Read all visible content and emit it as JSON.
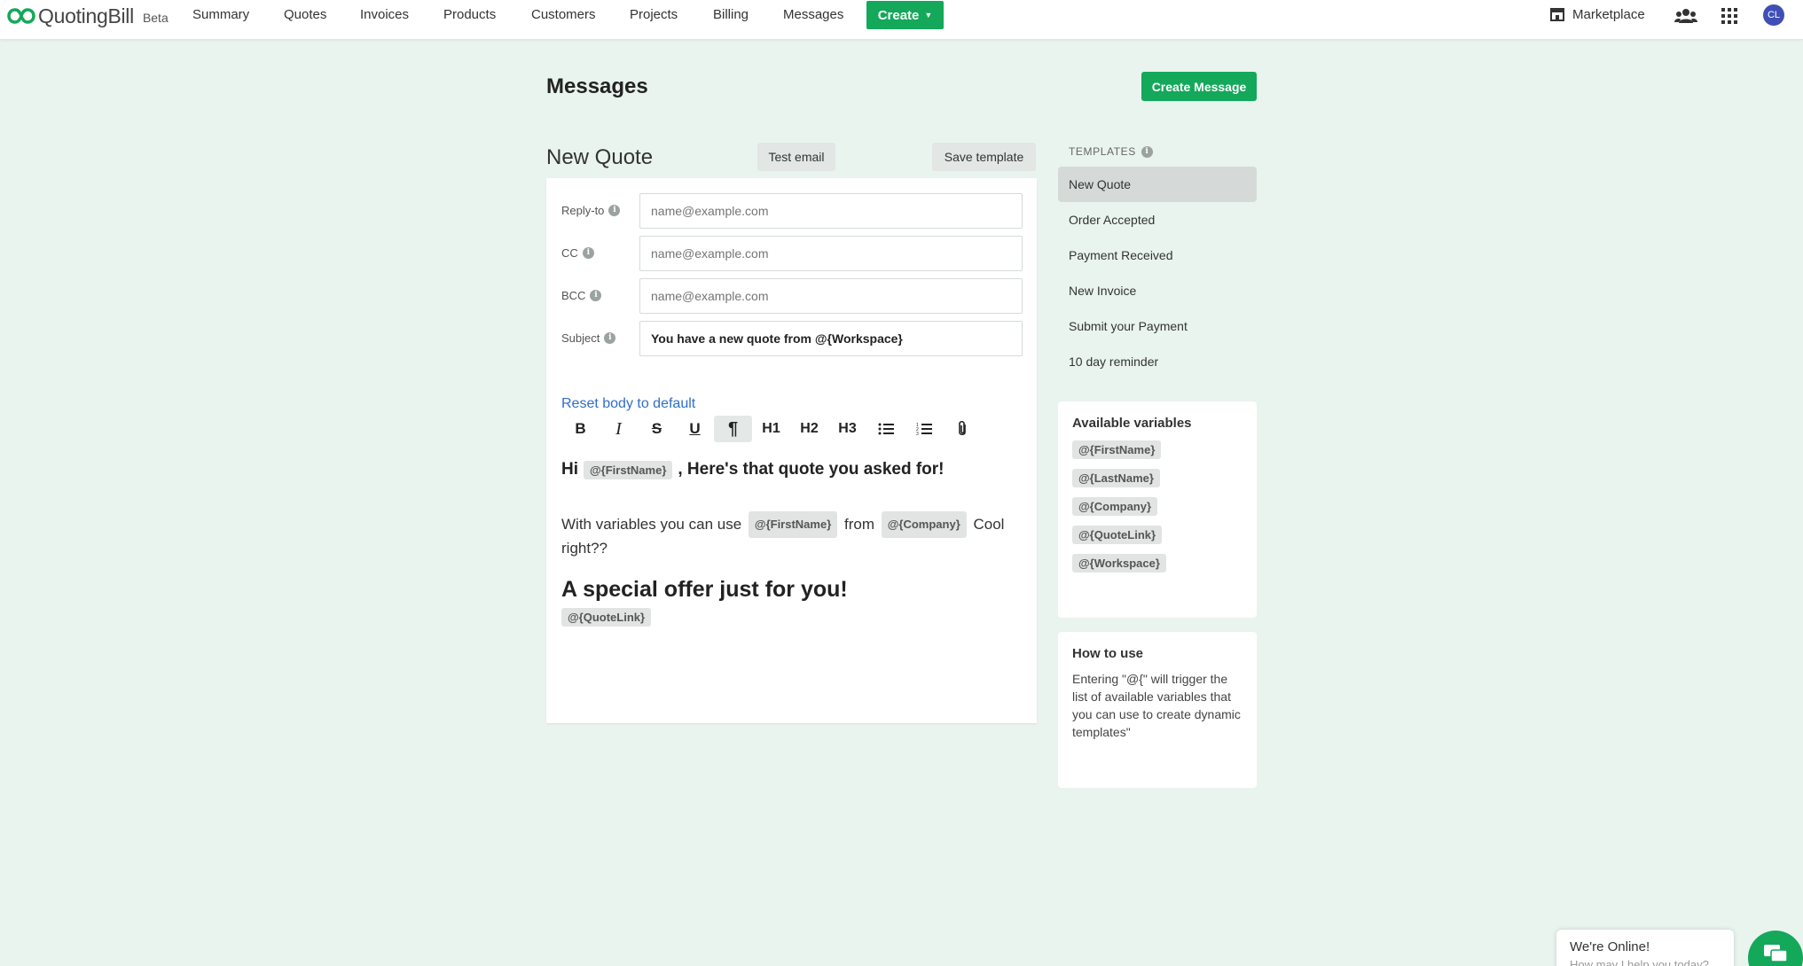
{
  "brand": {
    "name": "QuotingBill",
    "badge": "Beta",
    "logo_color": "#14a85a"
  },
  "nav": {
    "items": [
      "Summary",
      "Quotes",
      "Invoices",
      "Products",
      "Customers",
      "Projects",
      "Billing",
      "Messages"
    ],
    "create_label": "Create",
    "marketplace_label": "Marketplace",
    "avatar_initials": "CL"
  },
  "page": {
    "title": "Messages",
    "create_button": "Create Message"
  },
  "editor": {
    "template_name": "New Quote",
    "test_email_label": "Test email",
    "save_template_label": "Save template",
    "fields": [
      {
        "label": "Reply-to",
        "placeholder": "name@example.com",
        "value": ""
      },
      {
        "label": "CC",
        "placeholder": "name@example.com",
        "value": ""
      },
      {
        "label": "BCC",
        "placeholder": "name@example.com",
        "value": ""
      },
      {
        "label": "Subject",
        "placeholder": "",
        "value": "You have a new quote from @{Workspace}"
      }
    ],
    "reset_link": "Reset body to default",
    "toolbar": {
      "h1": "H1",
      "h2": "H2",
      "h3": "H3"
    },
    "body": {
      "greeting_hi": "Hi",
      "greeting_var": "@{FirstName}",
      "greeting_rest": ", Here's that quote you asked for!",
      "p_before": "With variables you can use",
      "p_var1": "@{FirstName}",
      "p_mid": "from",
      "p_var2": "@{Company}",
      "p_after": "Cool right??",
      "heading": "A special offer just for you!",
      "link_var": "@{QuoteLink}"
    }
  },
  "sidebar": {
    "templates_heading": "TEMPLATES",
    "templates": [
      "New Quote",
      "Order Accepted",
      "Payment Received",
      "New Invoice",
      "Submit your Payment",
      "10 day reminder"
    ],
    "active_template": "New Quote",
    "variables_title": "Available variables",
    "variables": [
      "@{FirstName}",
      "@{LastName}",
      "@{Company}",
      "@{QuoteLink}",
      "@{Workspace}"
    ],
    "howto_title": "How to use",
    "howto_text": "Entering \"@{\" will trigger the list of available variables that you can use to create dynamic templates\""
  },
  "chat": {
    "title": "We're Online!",
    "subtitle": "How may I help you today?"
  },
  "colors": {
    "accent": "#14a85a",
    "link": "#2f6fc9",
    "background": "#e9f4ef"
  }
}
